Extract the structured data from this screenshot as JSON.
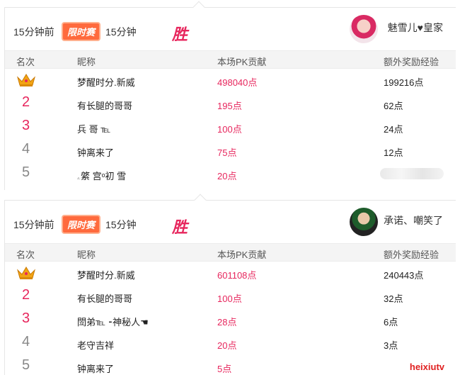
{
  "battles": [
    {
      "time_ago": "15分钟前",
      "badge": "限时赛",
      "duration": "15分钟",
      "result": "胜",
      "opponent_name": "魅雪儿♥皇家",
      "headers": {
        "rank": "名次",
        "name": "昵称",
        "pk": "本场PK贡献",
        "exp": "额外奖励经验"
      },
      "rows": [
        {
          "rank": "",
          "name": "梦醒时分.新威",
          "pk": "498040点",
          "exp": "199216点"
        },
        {
          "rank": "2",
          "name": "有长腿的哥哥",
          "pk": "195点",
          "exp": "62点"
        },
        {
          "rank": "3",
          "name": "兵 哥 ℡",
          "pk": "100点",
          "exp": "24点"
        },
        {
          "rank": "4",
          "name": "钟离来了",
          "pk": "75点",
          "exp": "12点"
        },
        {
          "rank": "5",
          "name": "ۦ綮 宫ᵒ初 雪",
          "pk": "20点",
          "exp": ""
        }
      ]
    },
    {
      "time_ago": "15分钟前",
      "badge": "限时赛",
      "duration": "15分钟",
      "result": "胜",
      "opponent_name": "承诺、嘲笑了",
      "headers": {
        "rank": "名次",
        "name": "昵称",
        "pk": "本场PK贡献",
        "exp": "额外奖励经验"
      },
      "rows": [
        {
          "rank": "",
          "name": "梦醒时分.新威",
          "pk": "601108点",
          "exp": "240443点"
        },
        {
          "rank": "2",
          "name": "有长腿的哥哥",
          "pk": "100点",
          "exp": "32点"
        },
        {
          "rank": "3",
          "name": "閚弟℡ ⁃神秘人☚",
          "pk": "28点",
          "exp": "6点"
        },
        {
          "rank": "4",
          "name": "老守吉祥",
          "pk": "20点",
          "exp": "3点"
        },
        {
          "rank": "5",
          "name": "钟离来了",
          "pk": "5点",
          "exp": ""
        }
      ]
    }
  ],
  "watermark": "heixiutv",
  "colors": {
    "accent": "#e7265d",
    "badge": "#ff6a3d",
    "header_bg": "#f4f4f4"
  }
}
